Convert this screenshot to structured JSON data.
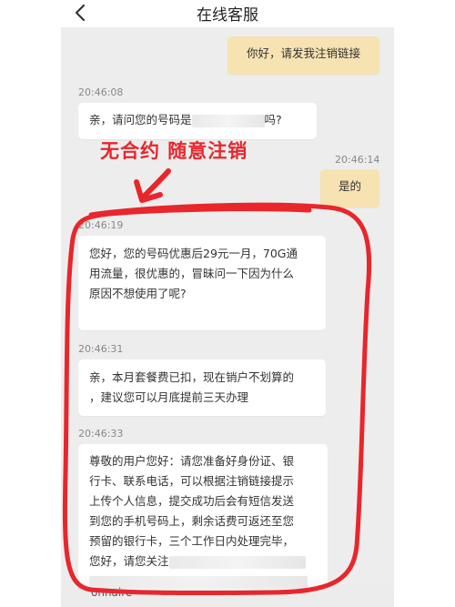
{
  "header": {
    "title": "在线客服",
    "back_icon": "chevron-left-icon"
  },
  "messages": [
    {
      "side": "out",
      "text": "你好，请发我注销链接"
    },
    {
      "timestamp": "20:46:08",
      "side": "in",
      "text_before": "亲，请问您的号码是",
      "text_after": "吗?"
    },
    {
      "timestamp": "20:46:14",
      "side": "out",
      "text": "是的"
    },
    {
      "timestamp": "20:46:19",
      "side": "in",
      "lines": [
        "您好，您的号码优惠后29元一月，70G通",
        "用流量，很优惠的，冒昧问一下因为什么",
        "原因不想使用了呢?"
      ]
    },
    {
      "timestamp": "20:46:31",
      "side": "in",
      "lines": [
        "亲，本月套餐费已扣，现在销户不划算的",
        "，建议您可以月底提前三天办理"
      ]
    },
    {
      "timestamp": "20:46:33",
      "side": "in",
      "lines": [
        "尊敬的用户您好：请您准备好身份证、银",
        "行卡、联系电话，可以根据注销链接提示",
        "上传个人信息，提交成功后会有短信发送",
        "到您的手机号码上，剩余话费可返还至您",
        "预留的银行卡，三个工作日内处理完毕，",
        "您好，请您关注"
      ]
    }
  ],
  "annotation": {
    "text": "无合约 随意注销",
    "color": "#e8262c"
  },
  "footer_cutoff_text": "onnaire",
  "colors": {
    "chat_background": "#ededed",
    "outgoing_bubble": "#f7e2b1",
    "incoming_bubble": "#ffffff"
  }
}
